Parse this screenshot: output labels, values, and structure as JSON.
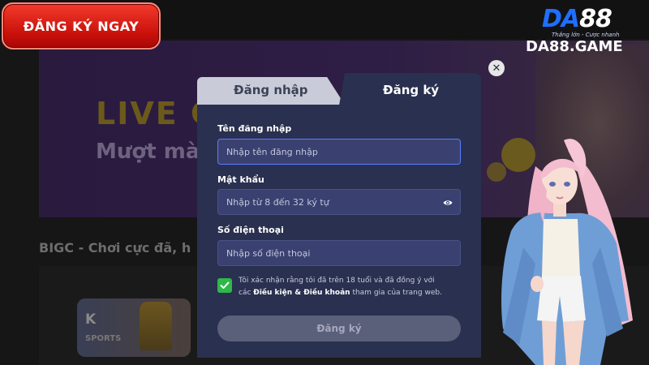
{
  "cta": {
    "register_now": "ĐĂNG KÝ NGAY"
  },
  "logo": {
    "brand_prefix": "DA",
    "brand_number": "88",
    "tagline": "Thắng lớn - Cược nhanh",
    "domain": "DA88.GAME"
  },
  "background": {
    "banner_title": "LIVE C",
    "banner_subtitle": "Mượt mà,",
    "section_title": "BIGC - Chơi cực đã, h",
    "card_letter": "K",
    "card_label": "SPORTS"
  },
  "modal": {
    "tabs": [
      {
        "label": "Đăng nhập",
        "active": false
      },
      {
        "label": "Đăng ký",
        "active": true
      }
    ],
    "fields": {
      "username": {
        "label": "Tên đăng nhập",
        "placeholder": "Nhập tên đăng nhập",
        "value": ""
      },
      "password": {
        "label": "Mật khẩu",
        "placeholder": "Nhập từ 8 đến 32 ký tự",
        "value": ""
      },
      "phone": {
        "label": "Số điện thoại",
        "placeholder": "Nhập số điện thoại",
        "value": ""
      }
    },
    "terms": {
      "checked": true,
      "text_before": "Tôi xác nhận rằng tôi đã trên 18 tuổi và đã đồng ý với các ",
      "link": "Điều kiện & Điều khoản",
      "text_after": " tham gia của trang web."
    },
    "submit_label": "Đăng ký"
  },
  "colors": {
    "accent_red": "#d9160f",
    "modal_bg": "#2a304f",
    "field_bg": "#3a4170",
    "check_green": "#2fb84a",
    "brand_blue": "#1f6fff"
  }
}
